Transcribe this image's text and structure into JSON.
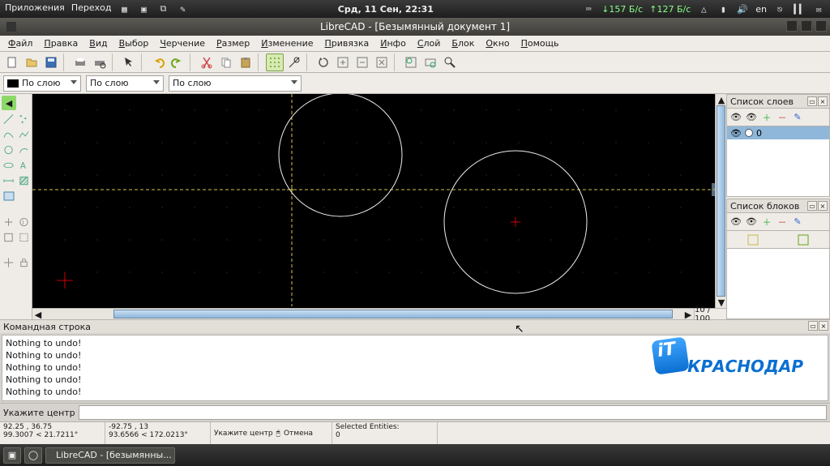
{
  "system_panel": {
    "apps": "Приложения",
    "places": "Переход",
    "clock": "Срд, 11 Сен, 22:31",
    "net_down": "↓157 Б/с",
    "net_up": "↑127 Б/с",
    "lang": "en"
  },
  "window": {
    "title": "LibreCAD - [Безымянный документ 1]"
  },
  "menubar": [
    "Файл",
    "Правка",
    "Вид",
    "Выбор",
    "Черчение",
    "Размер",
    "Изменение",
    "Привязка",
    "Инфо",
    "Слой",
    "Блок",
    "Окно",
    "Помощь"
  ],
  "selects": {
    "color_label": "По слою",
    "width_label": "По слою",
    "linetype_label": "По слою"
  },
  "canvas": {
    "zoom_label": "10 / 100"
  },
  "layers_panel": {
    "title": "Список слоев",
    "items": [
      {
        "name": "0"
      }
    ]
  },
  "blocks_panel": {
    "title": "Список блоков"
  },
  "command": {
    "title": "Командная строка",
    "lines": [
      "Nothing to undo!",
      "Nothing to undo!",
      "Nothing to undo!",
      "Nothing to undo!",
      "Nothing to undo!"
    ],
    "prompt_label": "Укажите центр",
    "logo_text": "КРАСНОДАР"
  },
  "status": {
    "abs_xy": "92.25 , 36.75",
    "abs_polar": "99.3007 < 21.7211°",
    "rel_xy": "-92.75 , 13",
    "rel_polar": "93.6566 < 172.0213°",
    "prompt": "Укажите центр",
    "undo_label": "Отмена",
    "sel": "Selected Entities:",
    "sel_n": "0"
  },
  "taskbar": {
    "task1": "LibreCAD - [безымянны..."
  }
}
